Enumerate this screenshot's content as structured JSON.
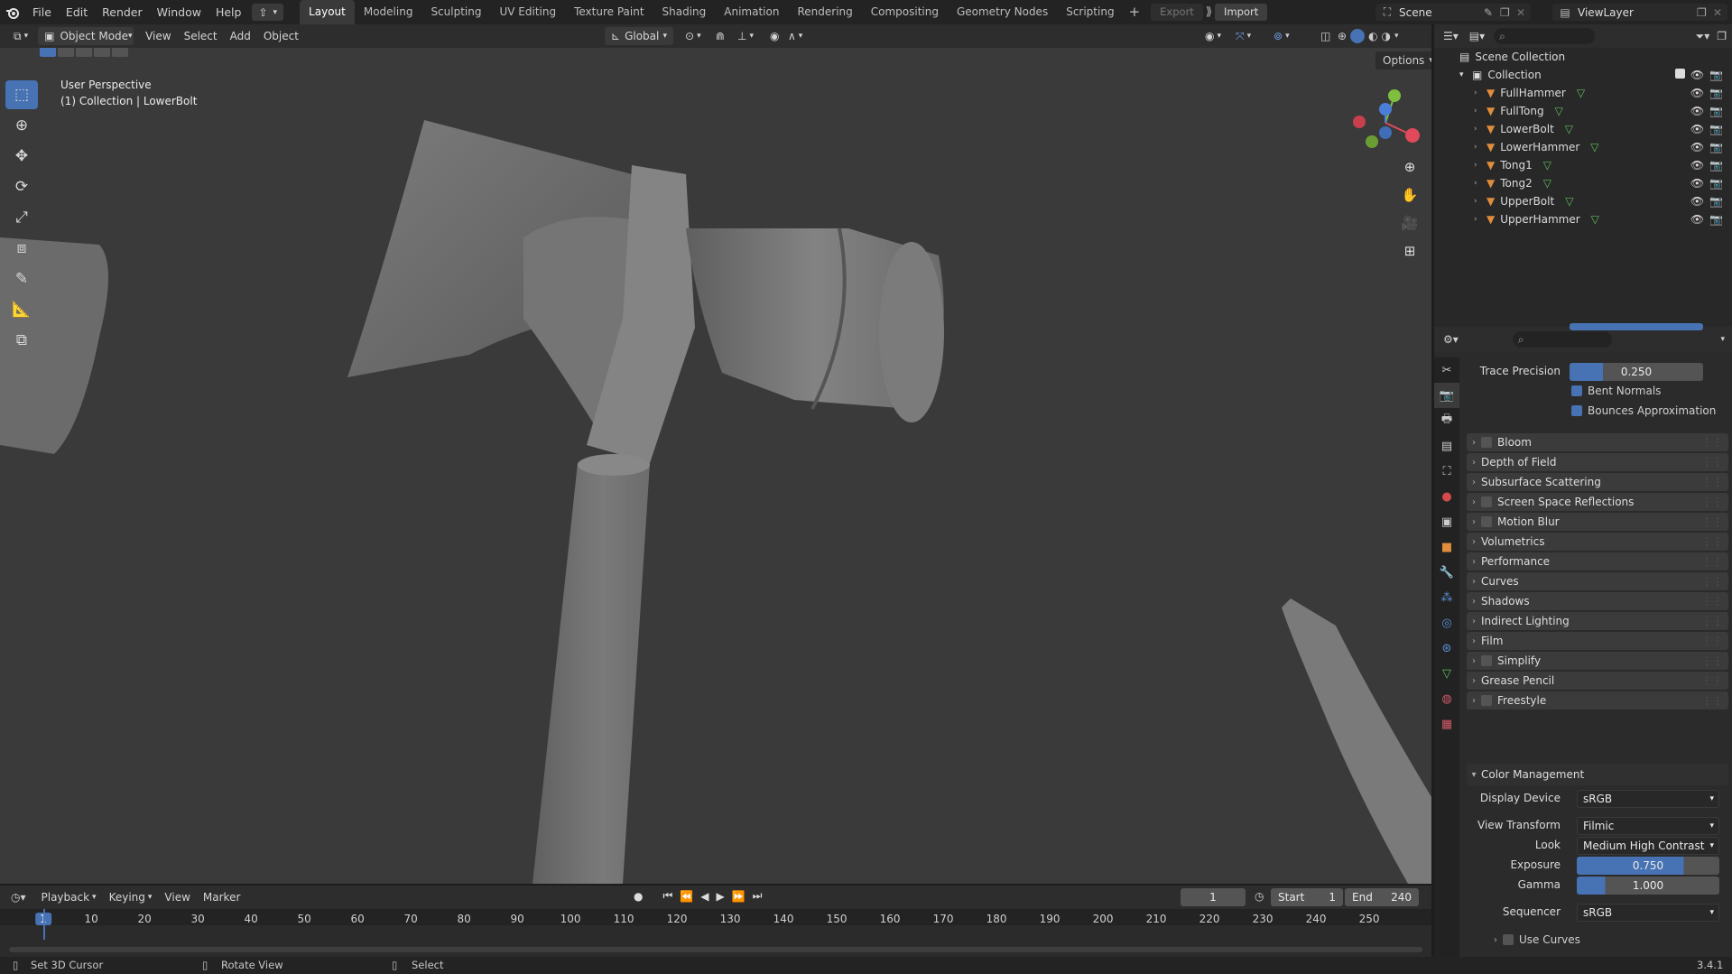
{
  "topbar": {
    "menus": [
      "File",
      "Edit",
      "Render",
      "Window",
      "Help"
    ],
    "workspaces": [
      "Layout",
      "Modeling",
      "Sculpting",
      "UV Editing",
      "Texture Paint",
      "Shading",
      "Animation",
      "Rendering",
      "Compositing",
      "Geometry Nodes",
      "Scripting"
    ],
    "active_workspace": "Layout",
    "export_label": "Export",
    "import_label": "Import",
    "scene": "Scene",
    "view_layer": "ViewLayer"
  },
  "viewport_header": {
    "mode": "Object Mode",
    "menus": [
      "View",
      "Select",
      "Add",
      "Object"
    ],
    "orientation": "Global",
    "options": "Options"
  },
  "viewport": {
    "perspective": "User Perspective",
    "collection_info": "(1) Collection | LowerBolt"
  },
  "outliner": {
    "root": "Scene Collection",
    "collection": "Collection",
    "objects": [
      "FullHammer",
      "FullTong",
      "LowerBolt",
      "LowerHammer",
      "Tong1",
      "Tong2",
      "UpperBolt",
      "UpperHammer"
    ]
  },
  "properties": {
    "trace_precision_label": "Trace Precision",
    "trace_precision_value": "0.250",
    "bent_normals": "Bent Normals",
    "bounces_approx": "Bounces Approximation",
    "panels": [
      {
        "label": "Bloom",
        "checkbox": true
      },
      {
        "label": "Depth of Field",
        "checkbox": false
      },
      {
        "label": "Subsurface Scattering",
        "checkbox": false
      },
      {
        "label": "Screen Space Reflections",
        "checkbox": true
      },
      {
        "label": "Motion Blur",
        "checkbox": true
      },
      {
        "label": "Volumetrics",
        "checkbox": false
      },
      {
        "label": "Performance",
        "checkbox": false
      },
      {
        "label": "Curves",
        "checkbox": false
      },
      {
        "label": "Shadows",
        "checkbox": false
      },
      {
        "label": "Indirect Lighting",
        "checkbox": false
      },
      {
        "label": "Film",
        "checkbox": false
      },
      {
        "label": "Simplify",
        "checkbox": true
      },
      {
        "label": "Grease Pencil",
        "checkbox": false
      },
      {
        "label": "Freestyle",
        "checkbox": true
      }
    ],
    "color_management": {
      "title": "Color Management",
      "display_device_label": "Display Device",
      "display_device": "sRGB",
      "view_transform_label": "View Transform",
      "view_transform": "Filmic",
      "look_label": "Look",
      "look": "Medium High Contrast",
      "exposure_label": "Exposure",
      "exposure": "0.750",
      "gamma_label": "Gamma",
      "gamma": "1.000",
      "sequencer_label": "Sequencer",
      "sequencer": "sRGB",
      "use_curves": "Use Curves"
    }
  },
  "timeline": {
    "menus": [
      "Playback",
      "Keying",
      "View",
      "Marker"
    ],
    "current_frame": "1",
    "start_label": "Start",
    "start": "1",
    "end_label": "End",
    "end": "240",
    "ticks": [
      "1",
      "10",
      "20",
      "30",
      "40",
      "50",
      "60",
      "70",
      "80",
      "90",
      "100",
      "110",
      "120",
      "130",
      "140",
      "150",
      "160",
      "170",
      "180",
      "190",
      "200",
      "210",
      "220",
      "230",
      "240",
      "250"
    ]
  },
  "statusbar": {
    "left": "Set 3D Cursor",
    "middle": "Rotate View",
    "right": "Select",
    "version": "3.4.1"
  },
  "colors": {
    "accent": "#4772b3",
    "object_icon": "#e08d3c",
    "mesh_icon": "#5fbf5f"
  }
}
